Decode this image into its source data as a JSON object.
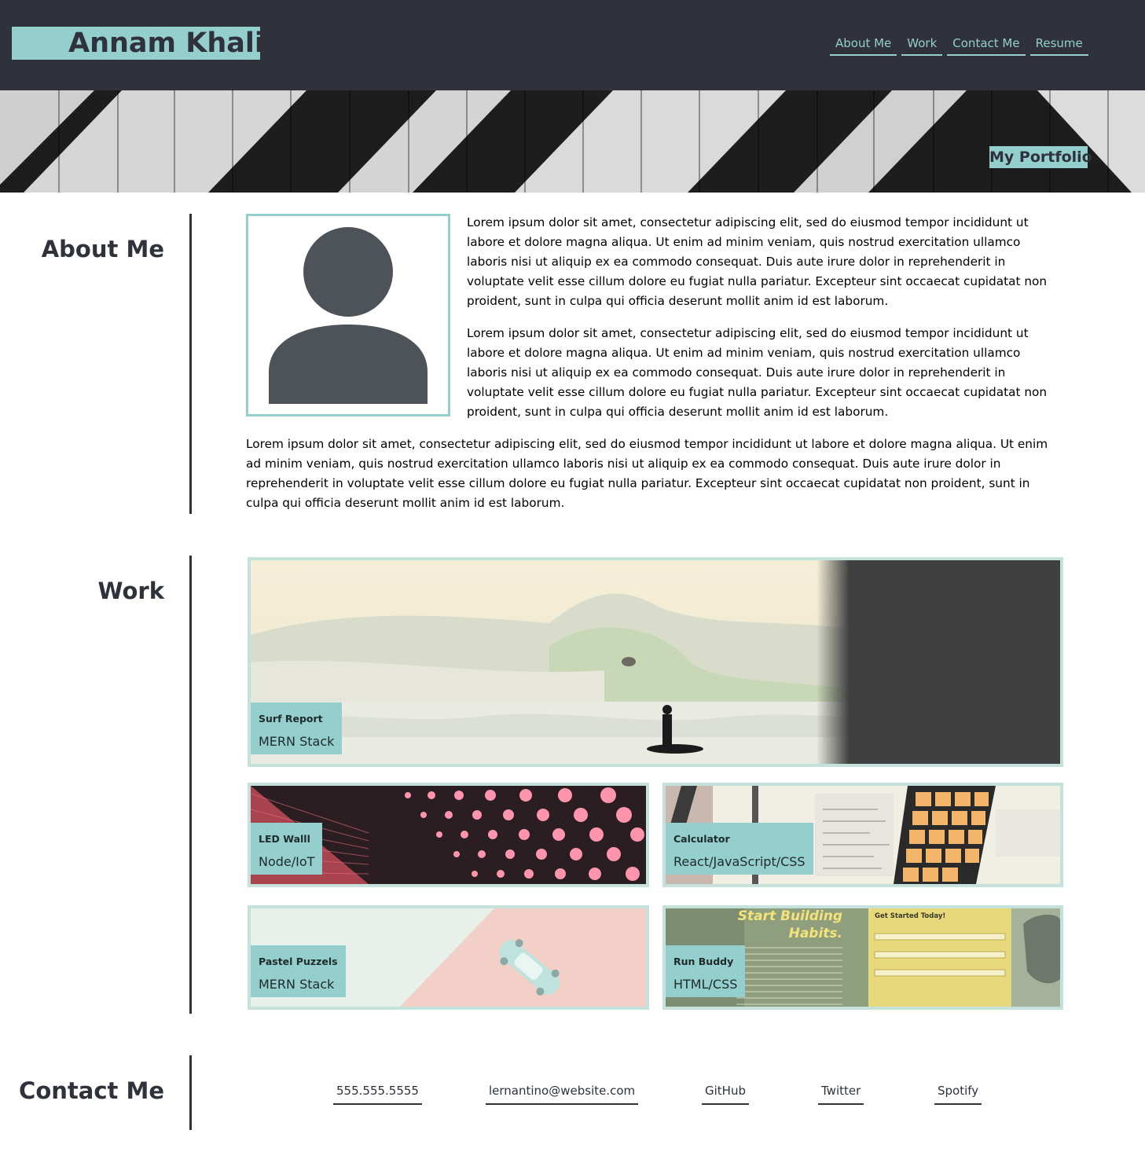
{
  "header": {
    "name": "Annam Khalid",
    "nav": [
      "About Me",
      "Work",
      "Contact Me",
      "Resume"
    ]
  },
  "hero": {
    "tag": "My Portfolio"
  },
  "about": {
    "title": "About Me",
    "paragraphs": [
      "Lorem ipsum dolor sit amet, consectetur adipiscing elit, sed do eiusmod tempor incididunt ut labore et dolore magna aliqua. Ut enim ad minim veniam, quis nostrud exercitation ullamco laboris nisi ut aliquip ex ea commodo consequat. Duis aute irure dolor in reprehenderit in voluptate velit esse cillum dolore eu fugiat nulla pariatur. Excepteur sint occaecat cupidatat non proident, sunt in culpa qui officia deserunt mollit anim id est laborum.",
      "Lorem ipsum dolor sit amet, consectetur adipiscing elit, sed do eiusmod tempor incididunt ut labore et dolore magna aliqua. Ut enim ad minim veniam, quis nostrud exercitation ullamco laboris nisi ut aliquip ex ea commodo consequat. Duis aute irure dolor in reprehenderit in voluptate velit esse cillum dolore eu fugiat nulla pariatur. Excepteur sint occaecat cupidatat non proident, sunt in culpa qui officia deserunt mollit anim id est laborum.",
      "Lorem ipsum dolor sit amet, consectetur adipiscing elit, sed do eiusmod tempor incididunt ut labore et dolore magna aliqua. Ut enim ad minim veniam, quis nostrud exercitation ullamco laboris nisi ut aliquip ex ea commodo consequat. Duis aute irure dolor in reprehenderit in voluptate velit esse cillum dolore eu fugiat nulla pariatur. Excepteur sint occaecat cupidatat non proident, sunt in culpa qui officia deserunt mollit anim id est laborum."
    ]
  },
  "work": {
    "title": "Work",
    "projects": [
      {
        "title": "Surf Report",
        "stack": "MERN Stack"
      },
      {
        "title": "LED Walll",
        "stack": "Node/IoT"
      },
      {
        "title": "Calculator",
        "stack": "React/JavaScript/CSS"
      },
      {
        "title": "Pastel Puzzels",
        "stack": "MERN Stack"
      },
      {
        "title": "Run Buddy",
        "stack": "HTML/CSS"
      }
    ],
    "runbuddy_image": {
      "headline1": "Start Building",
      "headline2": "Habits.",
      "form_title": "Get Started Today!"
    }
  },
  "contact": {
    "title": "Contact Me",
    "links": [
      "555.555.5555",
      "lernantino@website.com",
      "GitHub",
      "Twitter",
      "Spotify"
    ]
  },
  "colors": {
    "dark": "#2f313b",
    "accent": "#94cfcd",
    "card_border": "#c5e1db"
  }
}
